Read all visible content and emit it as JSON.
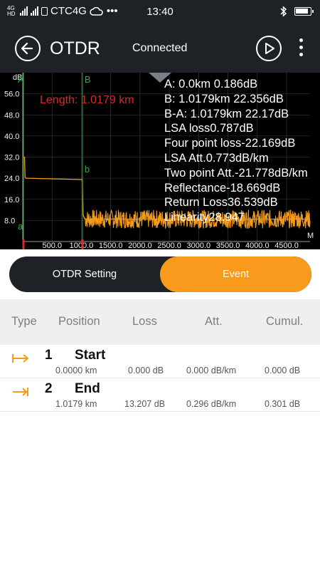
{
  "status_bar": {
    "network_top": "4G",
    "network_bottom": "HD",
    "carrier": "CTC4G",
    "dots": "•••",
    "time": "13:40",
    "bluetooth_icon": "bluetooth-icon",
    "battery_icon": "battery-icon",
    "battery_level": 0.9
  },
  "header": {
    "title": "OTDR",
    "status": "Connected",
    "back_icon": "arrow-left-icon",
    "play_icon": "play-icon",
    "menu_icon": "more-vertical-icon"
  },
  "chart_data": {
    "type": "line",
    "y_unit_label": "dB",
    "x_unit_label": "M",
    "yticks": [
      "56.0",
      "48.0",
      "40.0",
      "32.0",
      "24.0",
      "16.0",
      "8.0"
    ],
    "xticks": [
      "500.0",
      "1000.0",
      "1500.0",
      "2000.0",
      "2500.0",
      "3000.0",
      "3500.0",
      "4000.0",
      "4500.0"
    ],
    "ylim": [
      0,
      64
    ],
    "xlim": [
      0,
      4900
    ],
    "series": [
      {
        "x": [
          0,
          30,
          40,
          60,
          1000,
          1018,
          1020,
          1030,
          1060,
          4900
        ],
        "y": [
          32,
          32,
          24.3,
          24.0,
          23.5,
          23.3,
          20,
          10,
          8.5,
          8.5
        ]
      }
    ],
    "noise_floor_db": 8.5,
    "marker_a": {
      "label": "A",
      "sub_label": "a",
      "x": 0
    },
    "marker_b": {
      "label": "B",
      "sub_label": "b",
      "x": 1017.9
    },
    "length_label": "Length: 1.0179 km",
    "info_lines": [
      "A: 0.0km 0.186dB",
      "B: 1.0179km 22.356dB",
      "B-A: 1.0179km 22.17dB",
      "LSA loss0.787dB",
      "Four point loss-22.169dB",
      "LSA Att.0.773dB/km",
      "Two point Att.-21.778dB/km",
      "Reflectance-18.669dB",
      "Return Loss36.539dB",
      "Linearity28.947"
    ],
    "colors": {
      "trace": "#f59b1a",
      "marker_a": "#3fa64a",
      "marker_b": "#3fa64a",
      "length": "#d42b2b",
      "grid": "#2e4a3a"
    }
  },
  "tabs": [
    {
      "label": "OTDR Setting",
      "active": false
    },
    {
      "label": "Event",
      "active": true
    }
  ],
  "table": {
    "headers": [
      "Type",
      "Position",
      "Loss",
      "Att.",
      "Cumul."
    ],
    "rows": [
      {
        "icon": "event-start-icon",
        "num": "1",
        "name": "Start",
        "position": "0.0000 km",
        "loss": "0.000 dB",
        "att": "0.000 dB/km",
        "cumul": "0.000 dB"
      },
      {
        "icon": "event-end-icon",
        "num": "2",
        "name": "End",
        "position": "1.0179 km",
        "loss": "13.207 dB",
        "att": "0.296 dB/km",
        "cumul": "0.301 dB"
      }
    ]
  },
  "colors": {
    "accent": "#f99a1c",
    "dark": "#1e2126"
  }
}
